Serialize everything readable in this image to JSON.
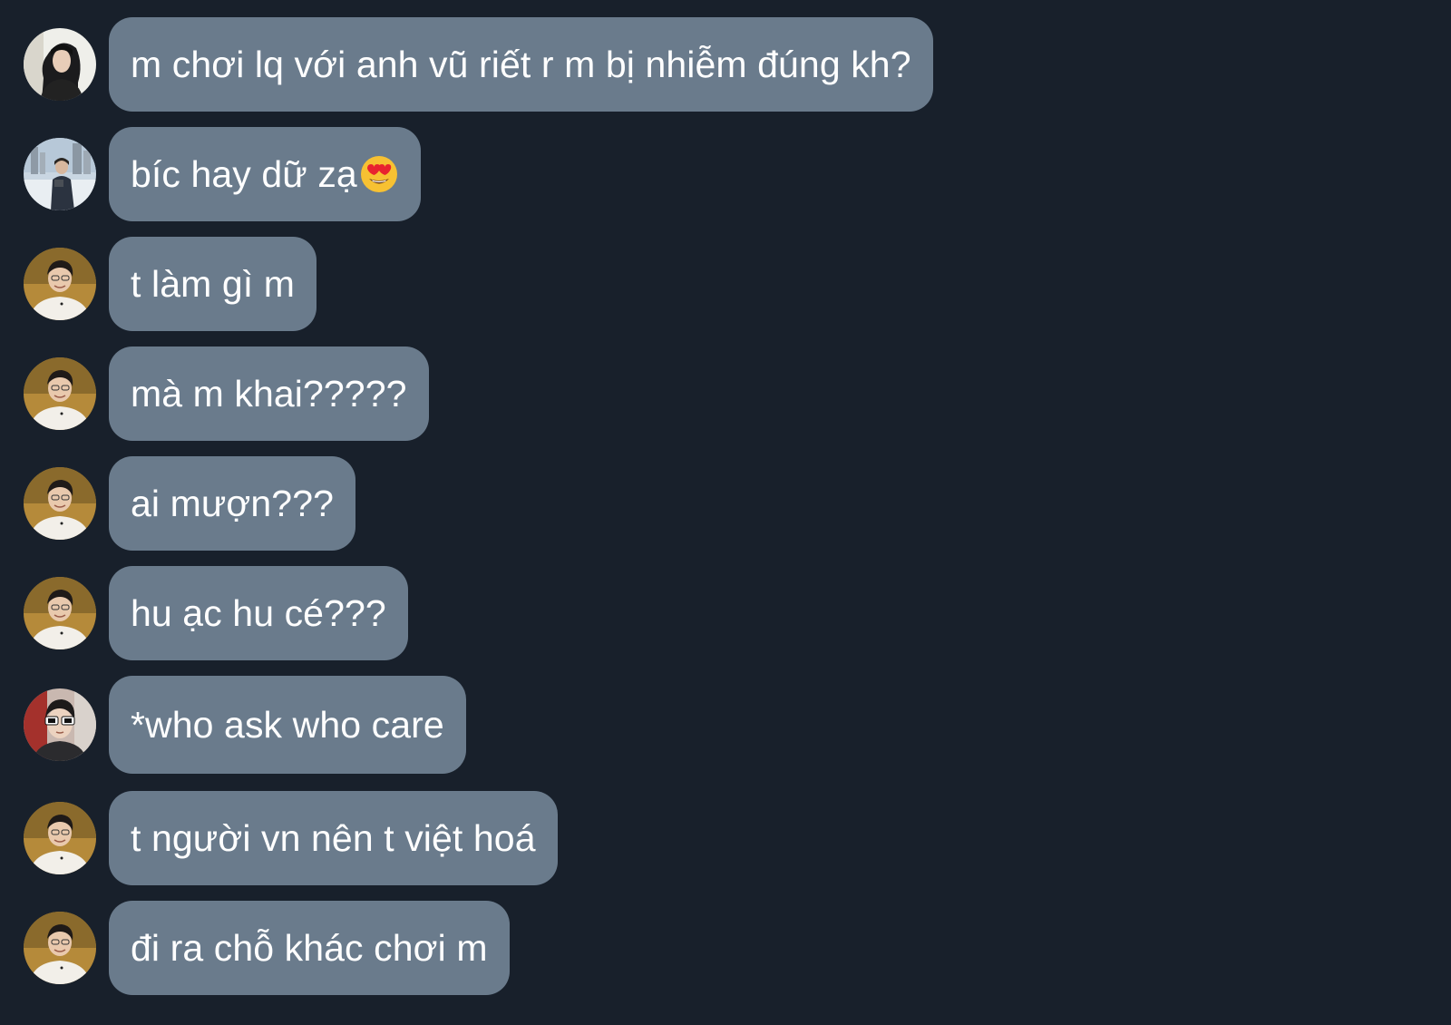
{
  "colors": {
    "background": "#18202b",
    "bubble": "#6a7b8c",
    "text": "#ffffff"
  },
  "messages": [
    {
      "avatar": "avatar-girl-dark-hair",
      "text": "m chơi lq với anh vũ riết r m bị nhiễm đúng kh?"
    },
    {
      "avatar": "avatar-person-outdoor-city",
      "text": "bíc hay dữ zạ",
      "emoji": "heart-eyes-emoji"
    },
    {
      "avatar": "avatar-boy-smiling",
      "text": "t làm gì m"
    },
    {
      "avatar": "avatar-boy-smiling",
      "text": "mà m khai?????"
    },
    {
      "avatar": "avatar-boy-smiling",
      "text": "ai mượn???"
    },
    {
      "avatar": "avatar-boy-smiling",
      "text": "hu ạc hu cé???"
    },
    {
      "avatar": "avatar-boy-sunglasses",
      "text": "*who ask who care"
    },
    {
      "avatar": "avatar-boy-smiling",
      "text": "t người vn nên t việt hoá"
    },
    {
      "avatar": "avatar-boy-smiling",
      "text": "đi ra chỗ khác chơi m"
    }
  ]
}
